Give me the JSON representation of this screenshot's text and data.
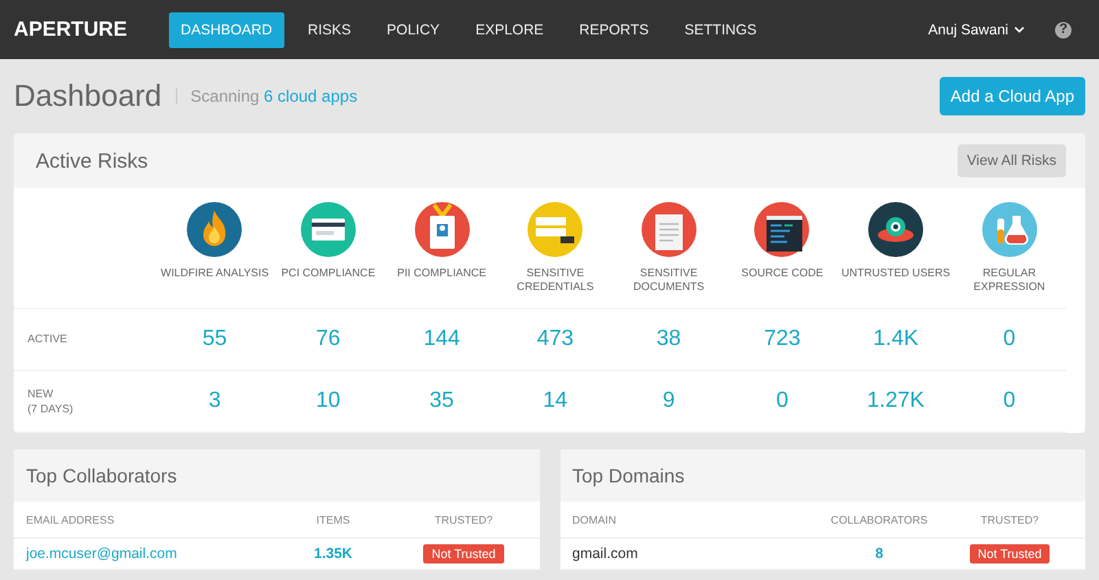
{
  "nav": {
    "brand": "APERTURE",
    "items": [
      {
        "label": "DASHBOARD",
        "selected": true
      },
      {
        "label": "RISKS",
        "selected": false
      },
      {
        "label": "POLICY",
        "selected": false
      },
      {
        "label": "EXPLORE",
        "selected": false
      },
      {
        "label": "REPORTS",
        "selected": false
      },
      {
        "label": "SETTINGS",
        "selected": false
      }
    ],
    "user": "Anuj Sawani",
    "help": "?"
  },
  "header": {
    "title": "Dashboard",
    "scanning": "Scanning",
    "apps_link": "6 cloud apps",
    "button": "Add a Cloud App"
  },
  "active_risks": {
    "title": "Active Risks",
    "button": "View All Risks",
    "row_labels": [
      "ACTIVE",
      "NEW\n(7 DAYS)"
    ],
    "risks": [
      {
        "label": "WILDFIRE ANALYSIS",
        "active": "55",
        "new": "3"
      },
      {
        "label": "PCI COMPLIANCE",
        "active": "76",
        "new": "10"
      },
      {
        "label": "PII COMPLIANCE",
        "active": "144",
        "new": "35"
      },
      {
        "label": "SENSITIVE CREDENTIALS",
        "active": "473",
        "new": "14"
      },
      {
        "label": "SENSITIVE DOCUMENTS",
        "active": "38",
        "new": "9"
      },
      {
        "label": "SOURCE CODE",
        "active": "723",
        "new": "0"
      },
      {
        "label": "UNTRUSTED USERS",
        "active": "1.4K",
        "new": "1.27K"
      },
      {
        "label": "REGULAR EXPRESSION",
        "active": "0",
        "new": "0"
      }
    ]
  },
  "top_collaborators": {
    "title": "Top Collaborators",
    "columns": [
      "EMAIL ADDRESS",
      "ITEMS",
      "TRUSTED?"
    ],
    "rows": [
      {
        "name": "joe.mcuser@gmail.com",
        "count": "1.35K",
        "badge": "Not Trusted",
        "trusted": false
      }
    ]
  },
  "top_domains": {
    "title": "Top Domains",
    "columns": [
      "DOMAIN",
      "COLLABORATORS",
      "TRUSTED?"
    ],
    "rows": [
      {
        "name": "gmail.com",
        "count": "8",
        "badge": "Not Trusted",
        "trusted": false
      }
    ]
  }
}
